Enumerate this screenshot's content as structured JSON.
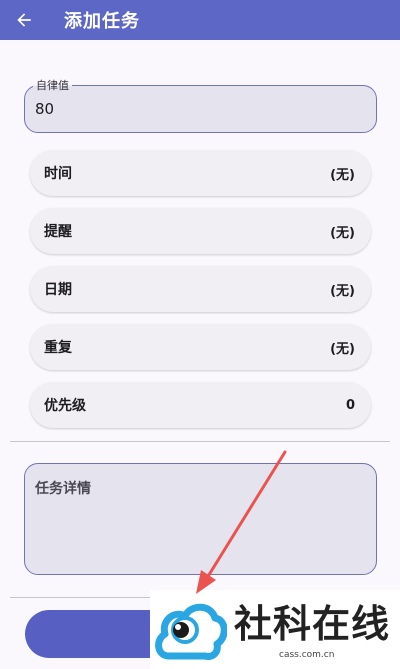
{
  "appbar": {
    "title": "添加任务",
    "back_icon": "arrow-left-icon"
  },
  "self_discipline": {
    "label": "自律值",
    "value": "80"
  },
  "rows": [
    {
      "label": "时间",
      "value": "(无)"
    },
    {
      "label": "提醒",
      "value": "(无)"
    },
    {
      "label": "日期",
      "value": "(无)"
    },
    {
      "label": "重复",
      "value": "(无)"
    },
    {
      "label": "优先级",
      "value": "0"
    }
  ],
  "details": {
    "placeholder": "任务详情"
  },
  "bottom_button": {
    "label": ""
  },
  "watermark": {
    "brand": "社科在线",
    "domain": "cass.com.cn"
  },
  "colors": {
    "primary": "#5c67c6",
    "field_border": "#6f74b8",
    "field_fill": "#e5e3ee",
    "background": "#fbf8fd",
    "annotation_arrow": "#ea5350"
  }
}
